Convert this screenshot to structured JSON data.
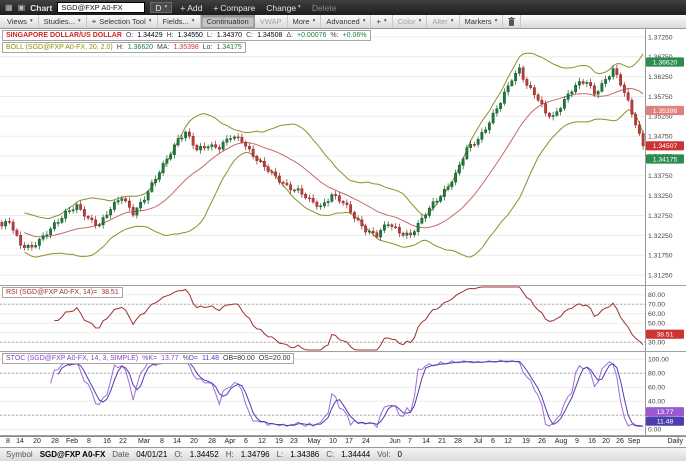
{
  "icons": {
    "caret": "▾",
    "plus": "+",
    "grid": "▦",
    "chart": "▣",
    "selection": "⌖"
  },
  "titlebar": {
    "app_label": "Chart",
    "symbol_input": "SGD@FXP A0-FX",
    "interval": "D",
    "add_label": "Add",
    "compare_label": "Compare",
    "change_label": "Change",
    "delete_label": "Delete"
  },
  "toolbar": {
    "views": "Views",
    "studies": "Studies...",
    "selection_tool": "Selection Tool",
    "fields": "Fields...",
    "continuation": "Continuation",
    "vwap": "VWAP",
    "more": "More",
    "advanced": "Advanced",
    "zoom": "+",
    "color": "Color",
    "alter": "Alter",
    "markers": "Markers"
  },
  "main_legend": {
    "symbol_name": "SINGAPORE DOLLAR/US DOLLAR",
    "o_label": "O:",
    "o": "1.34429",
    "h_label": "H:",
    "h": "1.34550",
    "l_label": "L:",
    "l": "1.34370",
    "c_label": "C:",
    "c": "1.34508",
    "delta_label": "Δ:",
    "delta": "+0.00076",
    "pct_label": "%:",
    "pct": "+0.06%"
  },
  "boll_legend": {
    "label": "BOLL (SGD@FXP A0-FX, 20, 2.0)",
    "h_label": "H:",
    "h": "1.36620",
    "ma_label": "MA:",
    "ma": "1.35398",
    "lo_label": "Lo:",
    "lo": "1.34175"
  },
  "rsi_legend": {
    "label": "RSI (SGD@FXP A0-FX, 14)=",
    "value": "38.51"
  },
  "stoc_legend": {
    "label": "STOC (SGD@FXP A0-FX, 14, 3, SIMPLE)",
    "k_label": "%K=",
    "k": "13.77",
    "d_label": "%D=",
    "d": "11.48",
    "ob": "OB=80.00",
    "os": "OS=20.00"
  },
  "statusbar": {
    "symbol_label": "Symbol",
    "symbol": "SGD@FXP A0-FX",
    "date_label": "Date",
    "date": "04/01/21",
    "o_label": "O:",
    "o": "1.34452",
    "h_label": "H:",
    "h": "1.34796",
    "l_label": "L:",
    "l": "1.34386",
    "c_label": "C:",
    "c": "1.34444",
    "vol_label": "Vol:",
    "vol": "0"
  },
  "chart_data": {
    "type": "candlestick",
    "symbol": "SGD@FXP A0-FX",
    "interval": "Daily",
    "price_panel": {
      "y_range": [
        1.311,
        1.3735
      ],
      "ticks": [
        "1.37250",
        "1.36750",
        "1.36250",
        "1.35750",
        "1.35250",
        "1.34750",
        "1.34250",
        "1.33750",
        "1.33250",
        "1.32750",
        "1.32250",
        "1.31750",
        "1.31250"
      ],
      "badges": [
        {
          "name": "boll-upper-badge",
          "value": "1.36620",
          "level": 1.3662,
          "color": "#2e8b4f"
        },
        {
          "name": "boll-mid-badge",
          "value": "1.35398",
          "level": 1.35398,
          "color": "#e0807e"
        },
        {
          "name": "last-price-badge",
          "value": "1.34507",
          "level": 1.34507,
          "color": "#cc3333"
        },
        {
          "name": "boll-lower-badge",
          "value": "1.34175",
          "level": 1.34175,
          "color": "#2e8b4f"
        }
      ],
      "candle_count": 172,
      "last_close": 1.34508,
      "price_path": [
        [
          0,
          1.3245
        ],
        [
          2,
          1.3262
        ],
        [
          5,
          1.3205
        ],
        [
          8,
          1.3192
        ],
        [
          11,
          1.3218
        ],
        [
          14,
          1.3256
        ],
        [
          17,
          1.3282
        ],
        [
          20,
          1.3295
        ],
        [
          23,
          1.3268
        ],
        [
          26,
          1.3255
        ],
        [
          29,
          1.329
        ],
        [
          32,
          1.332
        ],
        [
          35,
          1.3285
        ],
        [
          38,
          1.3318
        ],
        [
          41,
          1.3365
        ],
        [
          44,
          1.342
        ],
        [
          47,
          1.347
        ],
        [
          49,
          1.3482
        ],
        [
          52,
          1.3438
        ],
        [
          55,
          1.3455
        ],
        [
          58,
          1.3448
        ],
        [
          61,
          1.347
        ],
        [
          64,
          1.3465
        ],
        [
          67,
          1.343
        ],
        [
          70,
          1.3395
        ],
        [
          73,
          1.337
        ],
        [
          76,
          1.3352
        ],
        [
          79,
          1.3338
        ],
        [
          82,
          1.331
        ],
        [
          85,
          1.3298
        ],
        [
          88,
          1.333
        ],
        [
          91,
          1.3305
        ],
        [
          94,
          1.327
        ],
        [
          97,
          1.3242
        ],
        [
          100,
          1.3225
        ],
        [
          103,
          1.3252
        ],
        [
          106,
          1.3235
        ],
        [
          109,
          1.3228
        ],
        [
          112,
          1.3262
        ],
        [
          115,
          1.3305
        ],
        [
          118,
          1.334
        ],
        [
          121,
          1.3376
        ],
        [
          124,
          1.344
        ],
        [
          127,
          1.347
        ],
        [
          130,
          1.3512
        ],
        [
          133,
          1.3558
        ],
        [
          136,
          1.362
        ],
        [
          138,
          1.3648
        ],
        [
          140,
          1.3605
        ],
        [
          142,
          1.358
        ],
        [
          145,
          1.3532
        ],
        [
          147,
          1.3525
        ],
        [
          150,
          1.3568
        ],
        [
          153,
          1.36
        ],
        [
          156,
          1.3612
        ],
        [
          158,
          1.3585
        ],
        [
          161,
          1.3618
        ],
        [
          163,
          1.364
        ],
        [
          165,
          1.3605
        ],
        [
          167,
          1.3562
        ],
        [
          169,
          1.351
        ],
        [
          171,
          1.34508
        ]
      ],
      "bollinger": {
        "period": 20,
        "stddev": 2.0
      }
    },
    "rsi_panel": {
      "period": 14,
      "y_range": [
        24,
        86
      ],
      "ticks": [
        "80.00",
        "70.00",
        "60.00",
        "50.00",
        "40.00",
        "30.00"
      ],
      "guides": [
        70,
        30
      ],
      "badges": [
        {
          "name": "rsi-badge",
          "value": "38.51",
          "level": 38.51,
          "color": "#cc3333"
        }
      ]
    },
    "stoc_panel": {
      "k_period": 14,
      "d_period": 3,
      "ma_type": "SIMPLE",
      "overbought": 80,
      "oversold": 20,
      "y_range": [
        -4,
        106
      ],
      "ticks": [
        "100.00",
        "80.00",
        "60.00",
        "40.00",
        "20.00",
        "0.00"
      ],
      "guides": [
        80,
        20
      ],
      "badges": [
        {
          "name": "stoc-k-badge",
          "value": "13.77",
          "level": 13.77,
          "color": "#9b59d0"
        },
        {
          "name": "stoc-d-badge",
          "value": "11.48",
          "level": 11.48,
          "color": "#4b3fb0"
        }
      ]
    },
    "time_axis": {
      "interval_label": "Daily",
      "labels": [
        {
          "t": "8",
          "f": 0.012
        },
        {
          "t": "14",
          "f": 0.031
        },
        {
          "t": "20",
          "f": 0.058
        },
        {
          "t": "28",
          "f": 0.086
        },
        {
          "t": "Feb",
          "f": 0.111
        },
        {
          "t": "8",
          "f": 0.138
        },
        {
          "t": "16",
          "f": 0.166
        },
        {
          "t": "22",
          "f": 0.191
        },
        {
          "t": "Mar",
          "f": 0.224
        },
        {
          "t": "8",
          "f": 0.251
        },
        {
          "t": "14",
          "f": 0.274
        },
        {
          "t": "20",
          "f": 0.301
        },
        {
          "t": "28",
          "f": 0.329
        },
        {
          "t": "Apr",
          "f": 0.357
        },
        {
          "t": "6",
          "f": 0.381
        },
        {
          "t": "12",
          "f": 0.406
        },
        {
          "t": "19",
          "f": 0.433
        },
        {
          "t": "23",
          "f": 0.456
        },
        {
          "t": "May",
          "f": 0.487
        },
        {
          "t": "10",
          "f": 0.517
        },
        {
          "t": "17",
          "f": 0.541
        },
        {
          "t": "24",
          "f": 0.567
        },
        {
          "t": "Jun",
          "f": 0.613
        },
        {
          "t": "7",
          "f": 0.636
        },
        {
          "t": "14",
          "f": 0.66
        },
        {
          "t": "21",
          "f": 0.685
        },
        {
          "t": "28",
          "f": 0.71
        },
        {
          "t": "Jul",
          "f": 0.741
        },
        {
          "t": "6",
          "f": 0.765
        },
        {
          "t": "12",
          "f": 0.788
        },
        {
          "t": "19",
          "f": 0.815
        },
        {
          "t": "26",
          "f": 0.84
        },
        {
          "t": "Aug",
          "f": 0.87
        },
        {
          "t": "9",
          "f": 0.895
        },
        {
          "t": "16",
          "f": 0.918
        },
        {
          "t": "20",
          "f": 0.939
        },
        {
          "t": "26",
          "f": 0.961
        },
        {
          "t": "Sep",
          "f": 0.983
        }
      ]
    },
    "colors": {
      "up": "#1f7a3f",
      "up_stroke": "#145c2e",
      "down": "#c23b3b",
      "down_stroke": "#8e2a2a",
      "boll_band": "#8f8f2a",
      "boll_mid": "#c46a6a",
      "rsi_line": "#a03030",
      "stoc_k": "#9f6ad8",
      "stoc_d": "#4b3fb0",
      "grid": "#ececec",
      "guide": "#b0b0b0",
      "axis_text": "#444444",
      "axis_line": "#999999"
    }
  }
}
